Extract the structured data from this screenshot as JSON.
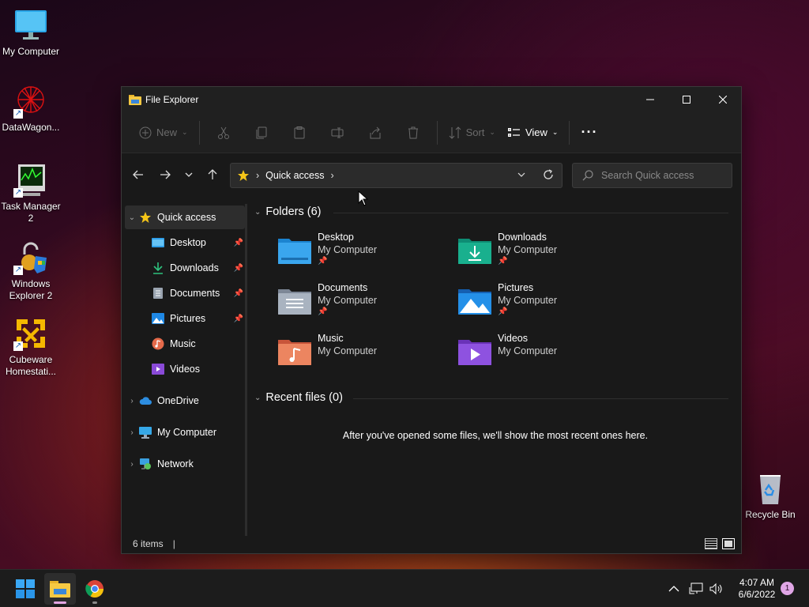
{
  "desktop": {
    "icons": [
      {
        "label": "My Computer"
      },
      {
        "label": "DataWagon..."
      },
      {
        "label": "Task Manager 2"
      },
      {
        "label": "Windows Explorer 2"
      },
      {
        "label": "Cubeware Homestati..."
      },
      {
        "label": "Recycle Bin"
      }
    ]
  },
  "window": {
    "title": "File Explorer",
    "toolbar": {
      "new_label": "New",
      "sort_label": "Sort",
      "view_label": "View",
      "more_label": "···"
    },
    "address": {
      "crumb": "Quick access"
    },
    "search": {
      "placeholder": "Search Quick access"
    },
    "sidebar": {
      "quick_access": "Quick access",
      "items": [
        {
          "label": "Desktop",
          "pinned": true
        },
        {
          "label": "Downloads",
          "pinned": true
        },
        {
          "label": "Documents",
          "pinned": true
        },
        {
          "label": "Pictures",
          "pinned": true
        },
        {
          "label": "Music",
          "pinned": false
        },
        {
          "label": "Videos",
          "pinned": false
        }
      ],
      "onedrive": "OneDrive",
      "my_computer": "My Computer",
      "network": "Network"
    },
    "content": {
      "folders_header": "Folders (6)",
      "folders": [
        {
          "name": "Desktop",
          "location": "My Computer",
          "pinned": true
        },
        {
          "name": "Downloads",
          "location": "My Computer",
          "pinned": true
        },
        {
          "name": "Documents",
          "location": "My Computer",
          "pinned": true
        },
        {
          "name": "Pictures",
          "location": "My Computer",
          "pinned": true
        },
        {
          "name": "Music",
          "location": "My Computer",
          "pinned": false
        },
        {
          "name": "Videos",
          "location": "My Computer",
          "pinned": false
        }
      ],
      "recent_header": "Recent files (0)",
      "recent_empty": "After you've opened some files, we'll show the most recent ones here."
    },
    "status": {
      "items": "6 items"
    }
  },
  "taskbar": {
    "time": "4:07 AM",
    "date": "6/6/2022",
    "notification_count": "1"
  },
  "colors": {
    "accent": "#0078d4",
    "window_bg": "#191919",
    "taskbar_bg": "#1c1c1c"
  }
}
